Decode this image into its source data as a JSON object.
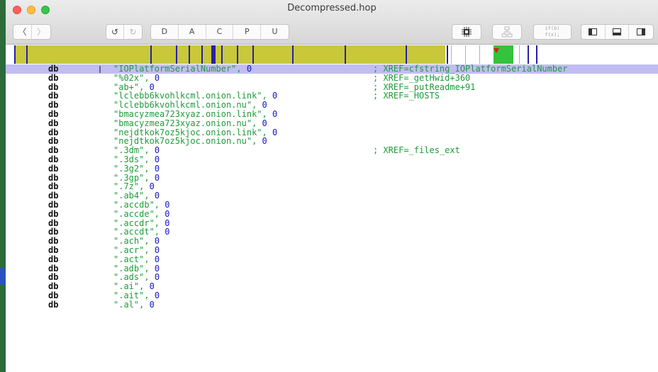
{
  "window": {
    "title": "Decompressed.hop"
  },
  "toolbar": {
    "nav": [
      {
        "icon": "chevron-left-icon",
        "glyph": "〈"
      },
      {
        "icon": "chevron-right-icon",
        "glyph": "〉"
      }
    ],
    "undo": [
      {
        "icon": "undo-icon",
        "glyph": "↺"
      },
      {
        "icon": "redo-icon",
        "glyph": "↻"
      }
    ],
    "type_buttons": [
      "D",
      "A",
      "C",
      "P",
      "U"
    ],
    "cpu_icon": "cpu-chip-icon",
    "graph_icon": "control-flow-graph-icon",
    "pseudo_code_lines": [
      "if(b)",
      "f(x);"
    ],
    "pane_icons": [
      "left-pane-icon",
      "bottom-pane-icon",
      "right-pane-icon"
    ]
  },
  "navbar": {
    "colors": {
      "data": "#c8c83a",
      "code": "#2a1fa8",
      "current": "#33c33c",
      "marker": "#e01818"
    }
  },
  "listing": {
    "rows": [
      {
        "mnemonic": "db",
        "value": "\"IOPlatformSerialNumber\"",
        "num": "0",
        "comment": "; XREF=cfstring_IOPlatformSerialNumber",
        "selected": true
      },
      {
        "mnemonic": "db",
        "value": "\"%02x\"",
        "num": "0",
        "comment": "; XREF=_getHwid+360"
      },
      {
        "mnemonic": "db",
        "value": "\"ab+\"",
        "num": "0",
        "comment": "; XREF=_putReadme+91"
      },
      {
        "mnemonic": "db",
        "value": "\"lclebb6kvohlkcml.onion.link\"",
        "num": "0",
        "comment": "; XREF=_HOSTS"
      },
      {
        "mnemonic": "db",
        "value": "\"lclebb6kvohlkcml.onion.nu\"",
        "num": "0",
        "comment": ""
      },
      {
        "mnemonic": "db",
        "value": "\"bmacyzmea723xyaz.onion.link\"",
        "num": "0",
        "comment": ""
      },
      {
        "mnemonic": "db",
        "value": "\"bmacyzmea723xyaz.onion.nu\"",
        "num": "0",
        "comment": ""
      },
      {
        "mnemonic": "db",
        "value": "\"nejdtkok7oz5kjoc.onion.link\"",
        "num": "0",
        "comment": ""
      },
      {
        "mnemonic": "db",
        "value": "\"nejdtkok7oz5kjoc.onion.nu\"",
        "num": "0",
        "comment": ""
      },
      {
        "mnemonic": "db",
        "value": "\".3dm\"",
        "num": "0",
        "comment": "; XREF=_files_ext"
      },
      {
        "mnemonic": "db",
        "value": "\".3ds\"",
        "num": "0",
        "comment": ""
      },
      {
        "mnemonic": "db",
        "value": "\".3g2\"",
        "num": "0",
        "comment": ""
      },
      {
        "mnemonic": "db",
        "value": "\".3gp\"",
        "num": "0",
        "comment": ""
      },
      {
        "mnemonic": "db",
        "value": "\".7z\"",
        "num": "0",
        "comment": ""
      },
      {
        "mnemonic": "db",
        "value": "\".ab4\"",
        "num": "0",
        "comment": ""
      },
      {
        "mnemonic": "db",
        "value": "\".accdb\"",
        "num": "0",
        "comment": ""
      },
      {
        "mnemonic": "db",
        "value": "\".accde\"",
        "num": "0",
        "comment": ""
      },
      {
        "mnemonic": "db",
        "value": "\".accdr\"",
        "num": "0",
        "comment": ""
      },
      {
        "mnemonic": "db",
        "value": "\".accdt\"",
        "num": "0",
        "comment": ""
      },
      {
        "mnemonic": "db",
        "value": "\".ach\"",
        "num": "0",
        "comment": ""
      },
      {
        "mnemonic": "db",
        "value": "\".acr\"",
        "num": "0",
        "comment": ""
      },
      {
        "mnemonic": "db",
        "value": "\".act\"",
        "num": "0",
        "comment": ""
      },
      {
        "mnemonic": "db",
        "value": "\".adb\"",
        "num": "0",
        "comment": ""
      },
      {
        "mnemonic": "db",
        "value": "\".ads\"",
        "num": "0",
        "comment": ""
      },
      {
        "mnemonic": "db",
        "value": "\".ai\"",
        "num": "0",
        "comment": ""
      },
      {
        "mnemonic": "db",
        "value": "\".ait\"",
        "num": "0",
        "comment": ""
      },
      {
        "mnemonic": "db",
        "value": "\".al\"",
        "num": "0",
        "comment": ""
      }
    ]
  }
}
